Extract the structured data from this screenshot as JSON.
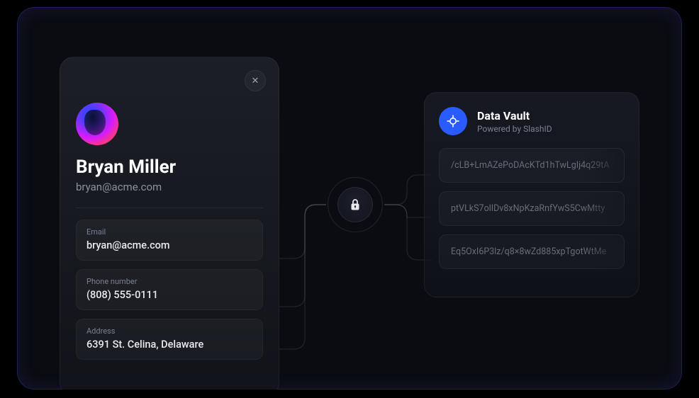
{
  "profile": {
    "name": "Bryan Miller",
    "email_display": "bryan@acme.com",
    "fields": [
      {
        "label": "Email",
        "value": "bryan@acme.com"
      },
      {
        "label": "Phone number",
        "value": "(808) 555-0111"
      },
      {
        "label": "Address",
        "value": "6391 St. Celina, Delaware"
      }
    ],
    "close_label": "✕"
  },
  "vault": {
    "title": "Data Vault",
    "subtitle": "Powered by SlashID",
    "ciphers": [
      "/cLB+LmAZePoDAcKTd1hTwLgIj4q29tA",
      "ptVLkS7olIDv8xNpKzaRnfYwS5CwMtty",
      "Eq5OxI6P3lz/q8×8wZd885xpTgotWtMe"
    ]
  },
  "colors": {
    "accent": "#2a5bff"
  }
}
